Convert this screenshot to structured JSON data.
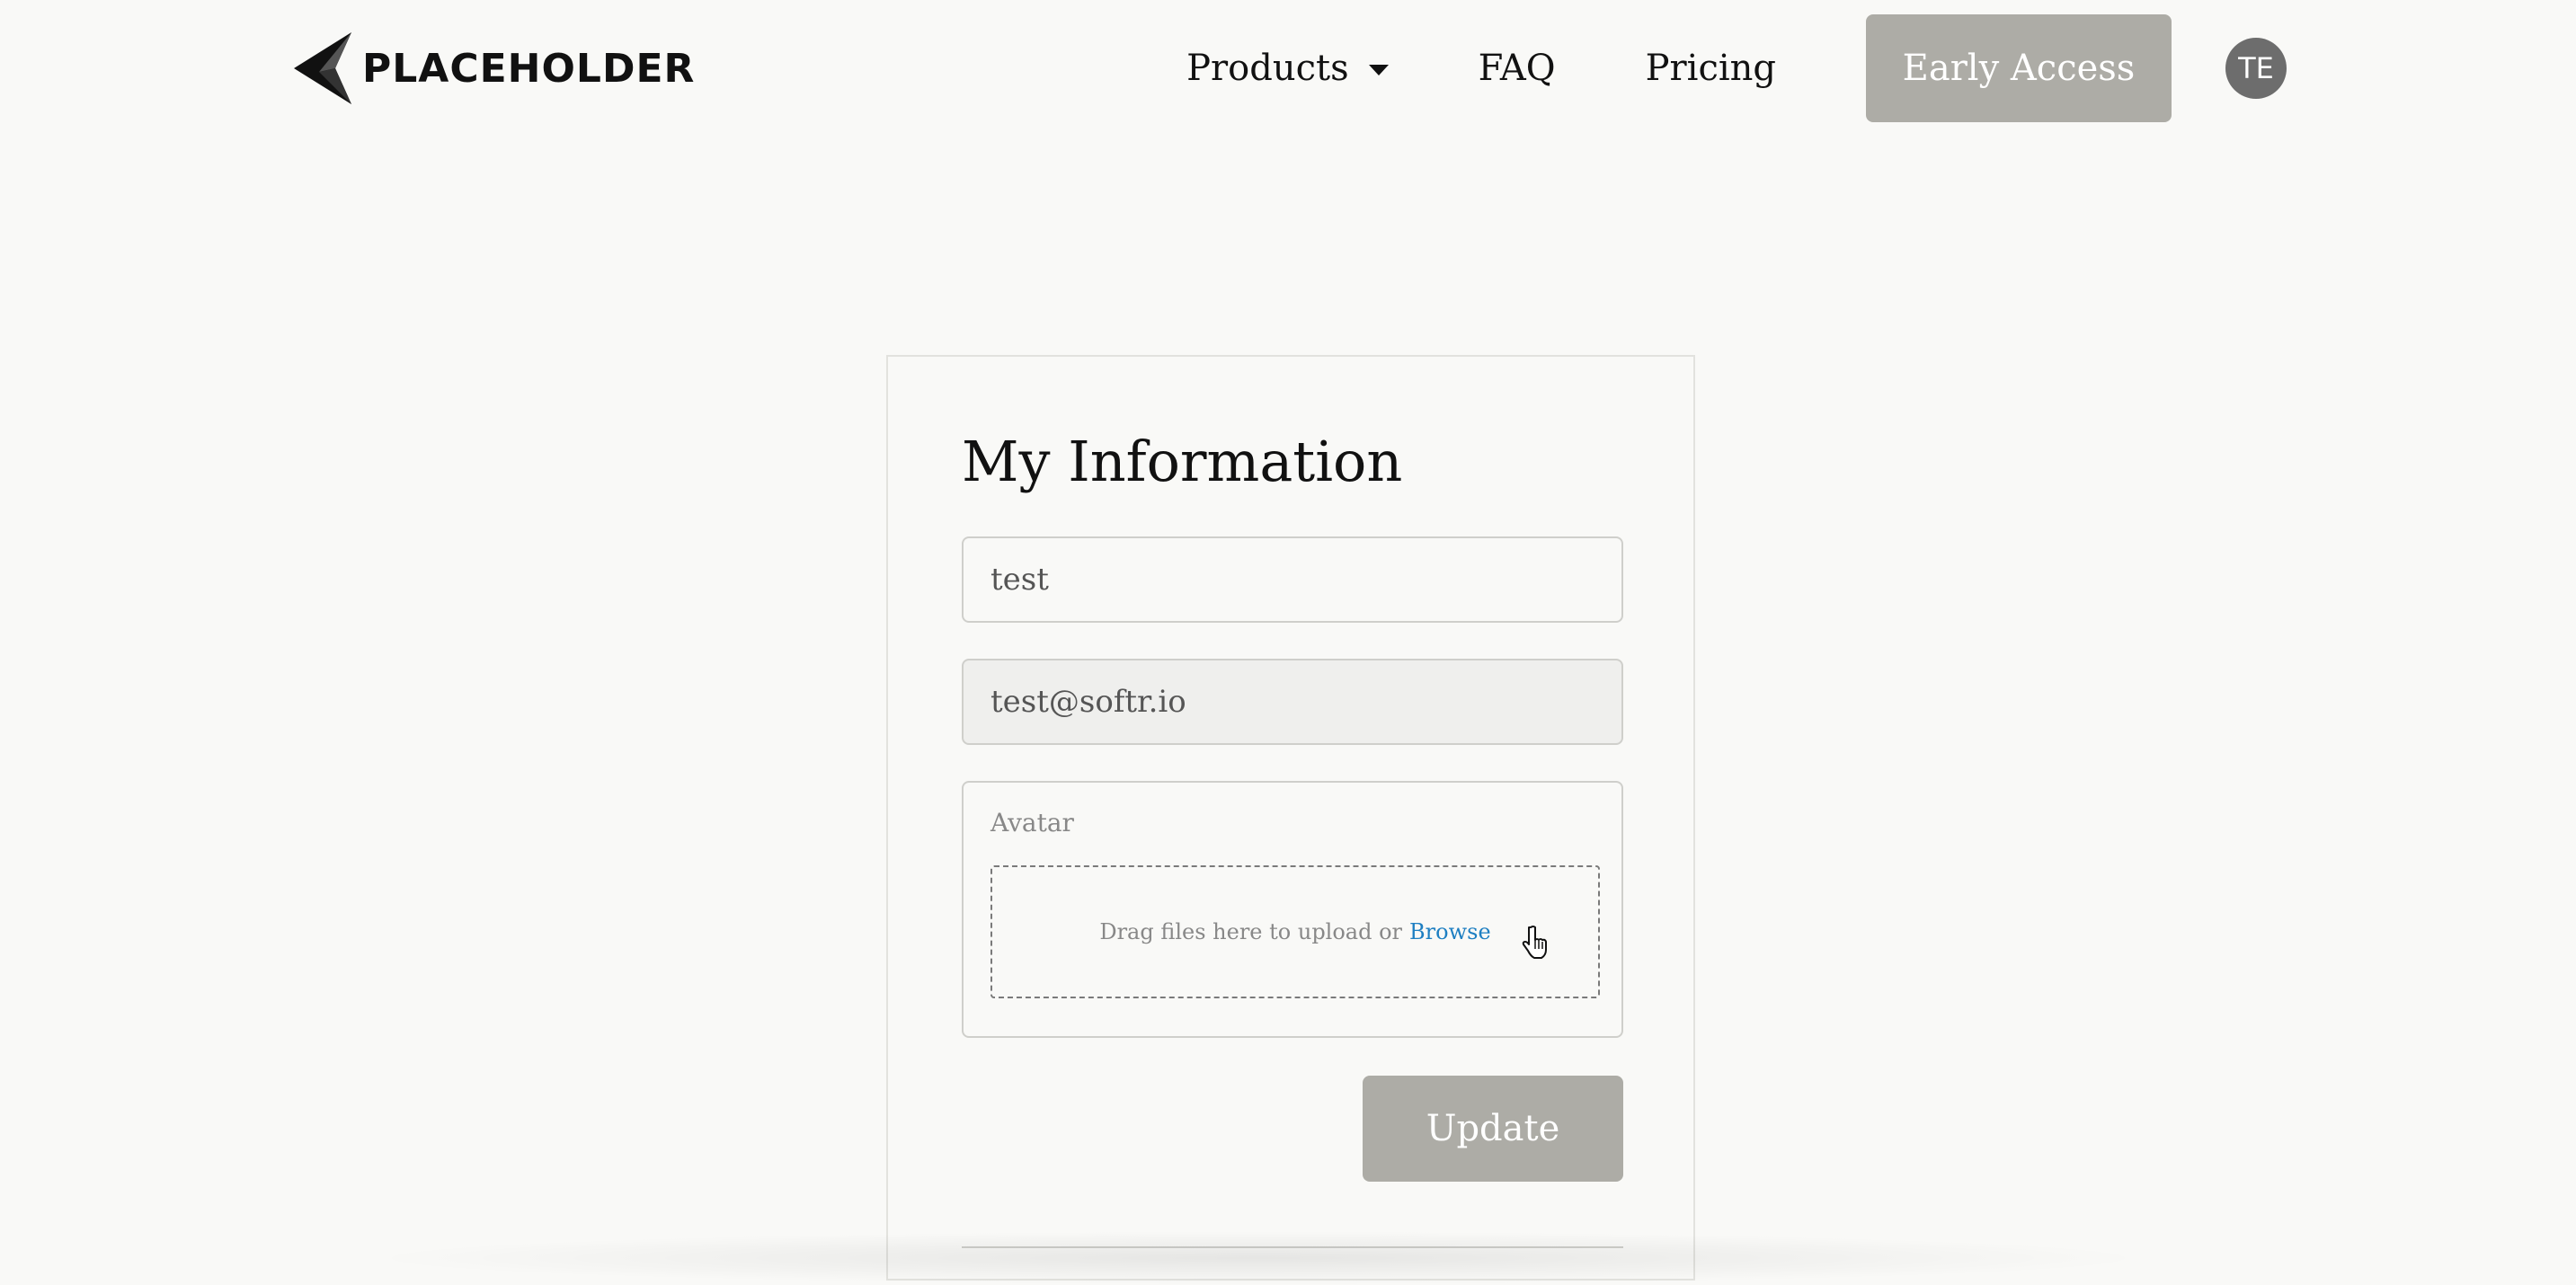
{
  "header": {
    "logo_text": "PLACEHOLDER",
    "nav": {
      "products_label": "Products",
      "faq_label": "FAQ",
      "pricing_label": "Pricing"
    },
    "cta_label": "Early Access",
    "avatar_initials": "TE"
  },
  "form": {
    "title": "My Information",
    "name_value": "test",
    "email_value": "test@softr.io",
    "avatar": {
      "label": "Avatar",
      "drop_text": "Drag files here to upload or",
      "browse_label": "Browse"
    },
    "submit_label": "Update"
  },
  "colors": {
    "background": "#f9f9f7",
    "button_bg": "#adaca6",
    "link": "#1e7fc2",
    "avatar_bg": "#6d6d6d"
  },
  "icons": {
    "logo": "paper-plane-logo-icon",
    "products_caret": "caret-down-icon",
    "cursor": "hand-pointer-icon"
  }
}
